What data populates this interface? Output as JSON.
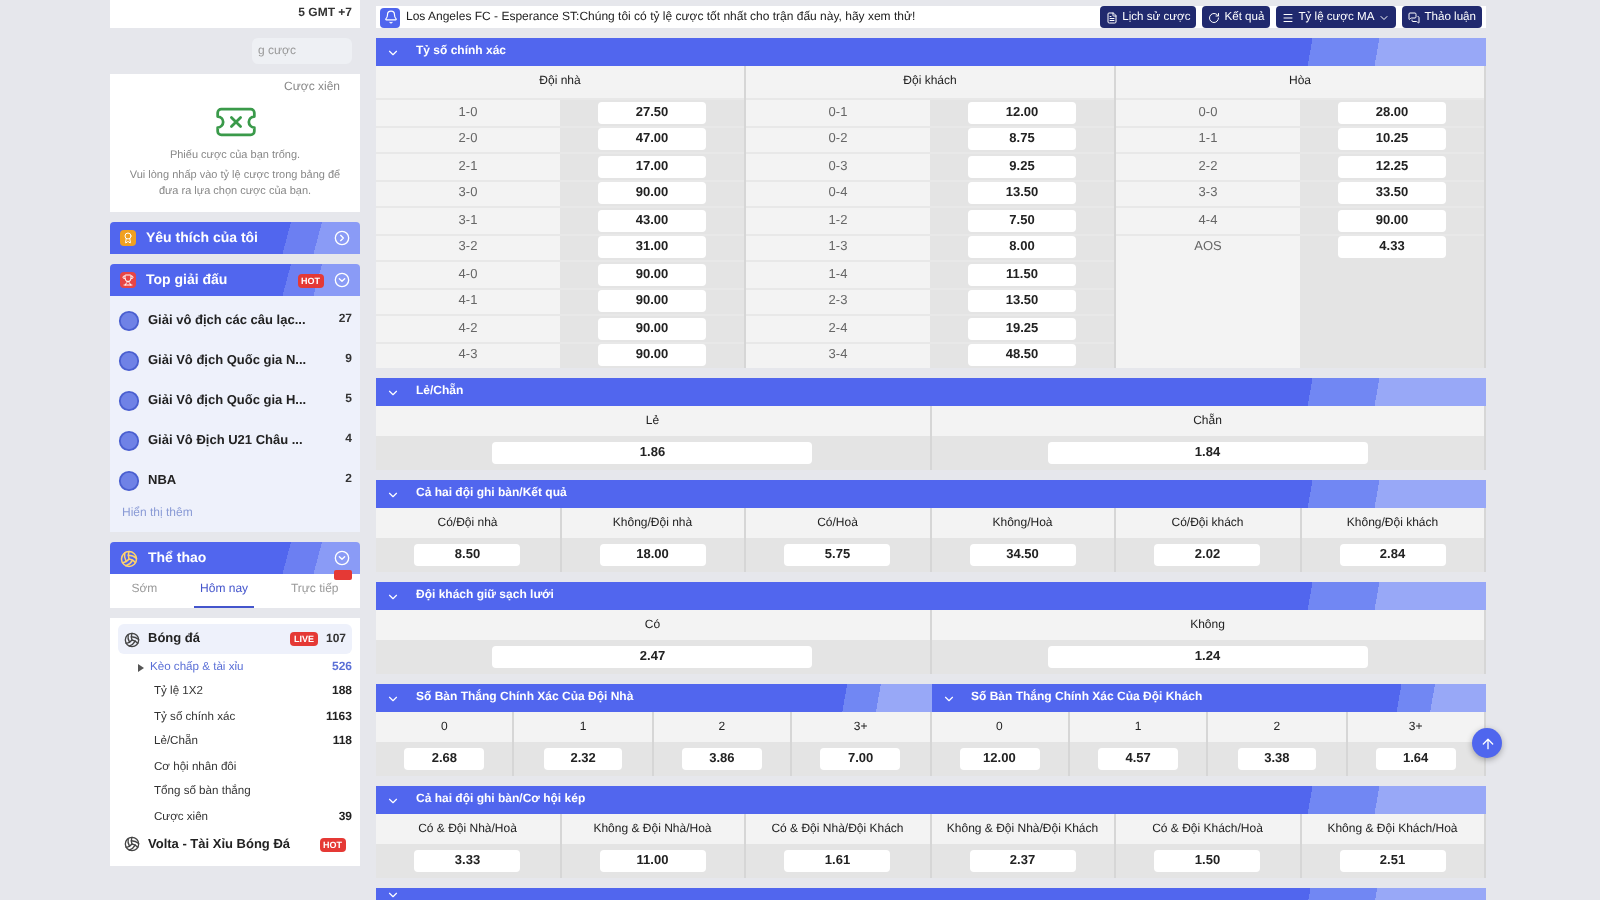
{
  "sidebar": {
    "timezone": "5 GMT +7",
    "search": {
      "placeholder": "g cược"
    },
    "slip_tab": "Cược xiên",
    "empty_slip": {
      "title": "Phiếu cược của bạn trống.",
      "message": "Vui lòng nhấp vào tỷ lệ cược trong bảng để đưa ra lựa chọn cược của bạn."
    },
    "favorites": {
      "title": "Yêu thích của tôi"
    },
    "top_leagues": {
      "title": "Top giải đấu",
      "badge": "HOT",
      "items": [
        {
          "name": "Giải vô địch các câu lạc...",
          "count": "27"
        },
        {
          "name": "Giải Vô địch Quốc gia N...",
          "count": "9"
        },
        {
          "name": "Giải Vô địch Quốc gia H...",
          "count": "5"
        },
        {
          "name": "Giải Vô Địch U21 Châu ...",
          "count": "4"
        },
        {
          "name": "NBA",
          "count": "2"
        }
      ],
      "more": "Hiển thị thêm"
    },
    "sports": {
      "title": "Thể thao",
      "tabs": [
        {
          "label": "Sớm",
          "selected": false,
          "badge": false
        },
        {
          "label": "Hôm nay",
          "selected": true,
          "badge": false
        },
        {
          "label": "Trực tiếp",
          "selected": false,
          "badge": true
        }
      ],
      "items": [
        {
          "name": "Bóng đá",
          "badge": "LIVE",
          "count": "107",
          "selected": true,
          "children": [
            {
              "name": "Kèo chấp & tài xỉu",
              "count": "526",
              "selected": true
            },
            {
              "name": "Tỷ lệ 1X2",
              "count": "188",
              "selected": false
            },
            {
              "name": "Tỷ số chính xác",
              "count": "1163",
              "selected": false
            },
            {
              "name": "Lẻ/Chẵn",
              "count": "118",
              "selected": false
            },
            {
              "name": "Cơ hội nhân đôi",
              "selected": false
            },
            {
              "name": "Tổng số bàn thắng",
              "selected": false
            },
            {
              "name": "Cược xiên",
              "count": "39",
              "selected": false
            }
          ]
        },
        {
          "name": "Volta - Tài Xỉu Bóng Đá",
          "badge": "HOT",
          "selected": false
        }
      ]
    }
  },
  "ticker": {
    "text": "Los Angeles FC - Esperance ST:Chúng tôi có tỷ lệ cược tốt nhất cho trận đấu này, hãy xem thử!"
  },
  "toolbar": [
    {
      "label": "Lịch sử cược",
      "kind": "history"
    },
    {
      "label": "Kết quả",
      "kind": "results"
    },
    {
      "label": "Tỷ lệ cược MA",
      "kind": "menu"
    },
    {
      "label": "Thảo luận",
      "kind": "chat"
    }
  ],
  "markets": [
    {
      "kind": "score-grid",
      "title": "Tỷ số chính xác",
      "groups": [
        {
          "heading": "Đội nhà",
          "rows": [
            {
              "score": "1-0",
              "odds": "27.50"
            },
            {
              "score": "2-0",
              "odds": "47.00"
            },
            {
              "score": "2-1",
              "odds": "17.00"
            },
            {
              "score": "3-0",
              "odds": "90.00"
            },
            {
              "score": "3-1",
              "odds": "43.00"
            },
            {
              "score": "3-2",
              "odds": "31.00"
            },
            {
              "score": "4-0",
              "odds": "90.00"
            },
            {
              "score": "4-1",
              "odds": "90.00"
            },
            {
              "score": "4-2",
              "odds": "90.00"
            },
            {
              "score": "4-3",
              "odds": "90.00"
            }
          ]
        },
        {
          "heading": "Đội khách",
          "rows": [
            {
              "score": "0-1",
              "odds": "12.00"
            },
            {
              "score": "0-2",
              "odds": "8.75"
            },
            {
              "score": "0-3",
              "odds": "9.25"
            },
            {
              "score": "0-4",
              "odds": "13.50"
            },
            {
              "score": "1-2",
              "odds": "7.50"
            },
            {
              "score": "1-3",
              "odds": "8.00"
            },
            {
              "score": "1-4",
              "odds": "11.50"
            },
            {
              "score": "2-3",
              "odds": "13.50"
            },
            {
              "score": "2-4",
              "odds": "19.25"
            },
            {
              "score": "3-4",
              "odds": "48.50"
            }
          ]
        },
        {
          "heading": "Hòa",
          "rows": [
            {
              "score": "0-0",
              "odds": "28.00"
            },
            {
              "score": "1-1",
              "odds": "10.25"
            },
            {
              "score": "2-2",
              "odds": "12.25"
            },
            {
              "score": "3-3",
              "odds": "33.50"
            },
            {
              "score": "4-4",
              "odds": "90.00"
            },
            {
              "score": "AOS",
              "odds": "4.33"
            }
          ]
        }
      ]
    },
    {
      "kind": "options",
      "title": "Lẻ/Chẵn",
      "options": [
        {
          "label": "Lẻ",
          "odds": "1.86"
        },
        {
          "label": "Chẵn",
          "odds": "1.84"
        }
      ]
    },
    {
      "kind": "options",
      "title": "Cả hai đội ghi bàn/Kết quả",
      "options": [
        {
          "label": "Có/Đội nhà",
          "odds": "8.50"
        },
        {
          "label": "Không/Đội nhà",
          "odds": "18.00"
        },
        {
          "label": "Có/Hoà",
          "odds": "5.75"
        },
        {
          "label": "Không/Hoà",
          "odds": "34.50"
        },
        {
          "label": "Có/Đội khách",
          "odds": "2.02"
        },
        {
          "label": "Không/Đội khách",
          "odds": "2.84"
        }
      ]
    },
    {
      "kind": "options",
      "title": "Đội khách giữ sạch lưới",
      "options": [
        {
          "label": "Có",
          "odds": "2.47"
        },
        {
          "label": "Không",
          "odds": "1.24"
        }
      ]
    },
    {
      "kind": "split",
      "panels": [
        {
          "title": "Số Bàn Thắng Chính Xác Của Đội Nhà",
          "options": [
            {
              "label": "0",
              "odds": "2.68"
            },
            {
              "label": "1",
              "odds": "2.32"
            },
            {
              "label": "2",
              "odds": "3.86"
            },
            {
              "label": "3+",
              "odds": "7.00"
            }
          ]
        },
        {
          "title": "Số Bàn Thắng Chính Xác Của Đội Khách",
          "options": [
            {
              "label": "0",
              "odds": "12.00"
            },
            {
              "label": "1",
              "odds": "4.57"
            },
            {
              "label": "2",
              "odds": "3.38"
            },
            {
              "label": "3+",
              "odds": "1.64"
            }
          ]
        }
      ]
    },
    {
      "kind": "options",
      "title": "Cả hai đội ghi bàn/Cơ hội kép",
      "options": [
        {
          "label": "Có & Đội Nhà/Hoà",
          "odds": "3.33"
        },
        {
          "label": "Không & Đội Nhà/Hoà",
          "odds": "11.00"
        },
        {
          "label": "Có & Đội Nhà/Đội Khách",
          "odds": "1.61"
        },
        {
          "label": "Không & Đội Nhà/Đội Khách",
          "odds": "2.37"
        },
        {
          "label": "Có & Đội Khách/Hoà",
          "odds": "1.50"
        },
        {
          "label": "Không & Đội Khách/Hoà",
          "odds": "2.51"
        }
      ]
    },
    {
      "kind": "bar"
    }
  ]
}
